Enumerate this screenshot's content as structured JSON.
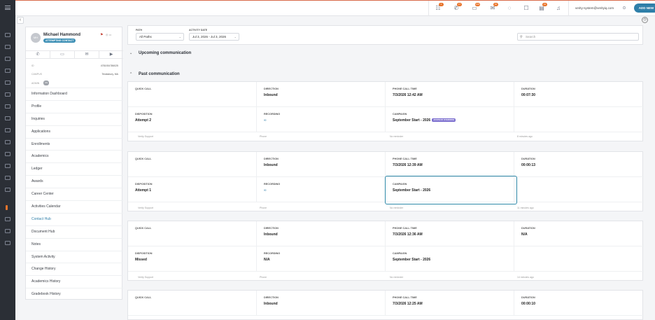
{
  "topbar": {
    "badges": [
      "1",
      "17",
      "100",
      "10",
      "",
      "",
      "21"
    ],
    "user_email": "verity-system@verityiq.com",
    "add_new": "ADD NEW"
  },
  "profile": {
    "initials": "MH",
    "name": "Michael Hammond",
    "status": "ATTEMPTING CONTACT",
    "id_label": "ID",
    "id_value": "4781934786025",
    "campus_label": "CAMPUS",
    "campus_value": "Tewksbury, MA",
    "admin_label": "ADMIN",
    "admin_badge": "VS"
  },
  "menu": [
    "Information Dashboard",
    "Profile",
    "Inquiries",
    "Applications",
    "Enrollments",
    "Academics",
    "Ledger",
    "Awards",
    "Career Center",
    "Activities Calendar",
    "Contact Hub",
    "Document Hub",
    "Notes",
    "System Activity",
    "Change History",
    "Academics History",
    "Gradebook History"
  ],
  "filters": {
    "path_label": "PATH",
    "path_value": "All Paths",
    "date_label": "ACTIVITY DATE",
    "date_value": "Jul 3, 2026 - Jul 3, 2026",
    "search_placeholder": "Search"
  },
  "sections": {
    "upcoming": "Upcoming communication",
    "past": "Past communication"
  },
  "labels": {
    "quick_call": "QUICK CALL",
    "direction": "DIRECTION",
    "phone_call_time": "PHONE CALL TIME",
    "duration": "DURATION",
    "disposition": "DISPOSITION",
    "recording": "RECORDING",
    "campaign": "CAMPAIGN"
  },
  "calls": [
    {
      "direction": "Inbound",
      "time": "7/3/2026 12:42 AM",
      "duration": "00:07:30",
      "disposition": "Attempt 2",
      "recording": "∞",
      "campaign": "September Start - 2026",
      "tag": "ADVISOR OVERRIDE",
      "by": "Verity Support",
      "channel": "Phone",
      "reminder": "No reminder",
      "ago": "8 minutes ago"
    },
    {
      "direction": "Inbound",
      "time": "7/3/2026 12:39 AM",
      "duration": "00:00:13",
      "disposition": "Attempt 1",
      "recording": "∞",
      "campaign": "September Start - 2026",
      "tag": "",
      "by": "Verity Support",
      "channel": "Phone",
      "reminder": "No reminder",
      "ago": "11 minutes ago"
    },
    {
      "direction": "Inbound",
      "time": "7/3/2026 12:36 AM",
      "duration": "N/A",
      "disposition": "Missed",
      "recording": "N/A",
      "campaign": "September Start - 2026",
      "tag": "",
      "by": "Verity Support",
      "channel": "Phone",
      "reminder": "No reminder",
      "ago": "14 minutes ago"
    },
    {
      "direction": "Inbound",
      "time": "7/3/2026 12:25 AM",
      "duration": "00:00:10",
      "disposition": "",
      "recording": "",
      "campaign": "",
      "tag": "",
      "by": "",
      "channel": "",
      "reminder": "",
      "ago": ""
    }
  ]
}
